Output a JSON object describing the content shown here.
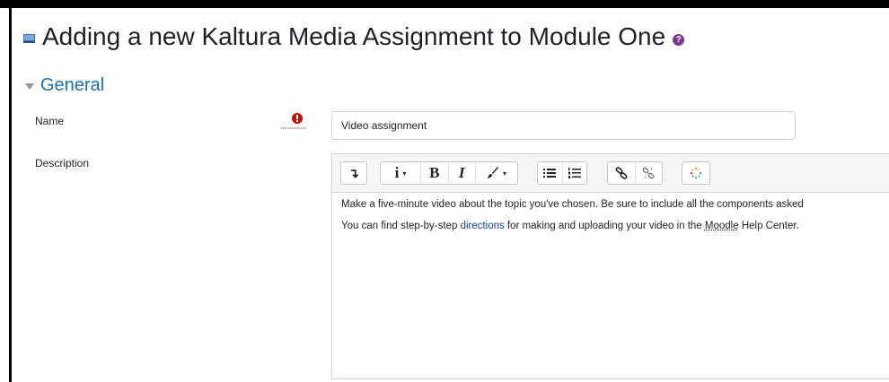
{
  "page": {
    "title": "Adding a new Kaltura Media Assignment to Module One"
  },
  "section": {
    "label": "General"
  },
  "form": {
    "name_label": "Name",
    "name_value": "Video assignment",
    "description_label": "Description"
  },
  "toolbar": {
    "paragraph_glyph": "↴",
    "info_glyph": "i",
    "bold_glyph": "B",
    "italic_glyph": "I",
    "dropdown_glyph": "▾"
  },
  "description": {
    "line1": "Make a five-minute video about the topic you've chosen. Be sure to include all the components asked",
    "line2_pre": "You can find step-by-step ",
    "line2_link": "directions",
    "line2_mid": " for making and uploading your video in the ",
    "line2_moodle": "Moodle",
    "line2_post": " Help Center."
  },
  "colors": {
    "section_header": "#1d6fa5",
    "required": "#c40e0e",
    "help_icon": "#7c3a93",
    "link": "#0f47ad"
  }
}
